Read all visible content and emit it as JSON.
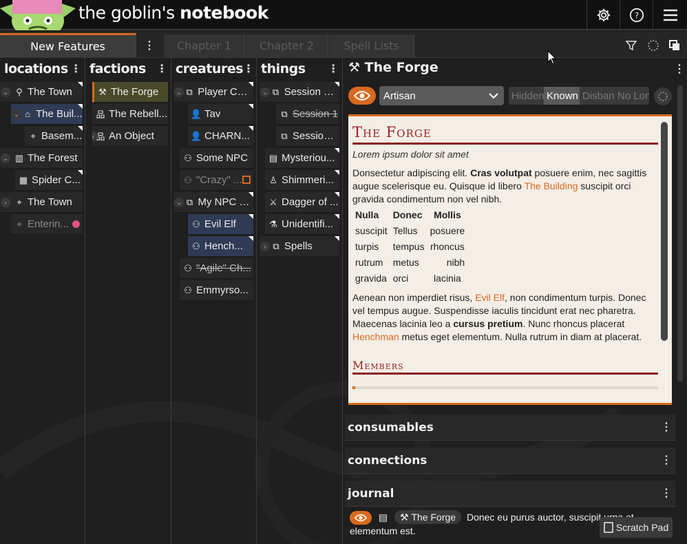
{
  "app": {
    "title_a": "the goblin's ",
    "title_b": "notebook"
  },
  "tabs": [
    {
      "label": "New Features"
    },
    {
      "label": "Chapter 1"
    },
    {
      "label": "Chapter 2"
    },
    {
      "label": "Spell Lists"
    }
  ],
  "columns": {
    "locations": {
      "title": "locations",
      "items": [
        "The Town",
        "The Buil...",
        "Basem...",
        "The Forest",
        "Spider C...",
        "The Town",
        "Enterin..."
      ]
    },
    "factions": {
      "title": "factions",
      "items": [
        "The Forge",
        "The Rebell...",
        "An Object"
      ]
    },
    "creatures": {
      "title": "creatures",
      "items": [
        "Player Cha...",
        "Tav",
        "CHARN...",
        "Some NPC",
        "\"Crazy\" ...",
        "My NPC G...",
        "Evil Elf",
        "Hench...",
        "\"Agile\" Ch...",
        "Emmyrso..."
      ]
    },
    "things": {
      "title": "things",
      "items": [
        "Session Pl...",
        "Session 1",
        "Session ...",
        "Mysteriou...",
        "Shimmeri...",
        "Dagger of ...",
        "Unidentifi...",
        "Spells"
      ]
    }
  },
  "panel": {
    "title": "The Forge",
    "type_select": "Artisan",
    "status_options": [
      "Hidden",
      "Known",
      "Disbanded",
      "No Longer"
    ],
    "status_selected": "Known",
    "card": {
      "heading": "The Forge",
      "subtitle": "Lorem ipsum dolor sit amet",
      "p1a": "Donsectetur adipiscing elit. ",
      "p1b": "Cras volutpat",
      "p1c": " posuere enim, nec sagittis augue scelerisque eu. Quisque id libero ",
      "p1link": "The Building",
      "p1d": " suscipit orci gravida condimentum non vel nibh.",
      "table": {
        "headers": [
          "Nulla",
          "Donec",
          "Mollis"
        ],
        "rows": [
          [
            "suscipit",
            "Tellus",
            "posuere"
          ],
          [
            "turpis",
            "tempus",
            "rhoncus"
          ],
          [
            "rutrum",
            "metus",
            "nibh"
          ],
          [
            "gravida",
            "orci",
            "lacinia"
          ]
        ]
      },
      "p2a": "Aenean non imperdiet risus, ",
      "p2link1": "Evil Elf",
      "p2b": ", non condimentum turpis. Donec vel tempus augue. Suspendisse iaculis tincidunt erat nec pharetra. Maecenas lacinia leo a ",
      "p2c": "cursus pretium",
      "p2d": ". Nunc rhoncus placerat ",
      "p2link2": "Henchman",
      "p2e": " metus eget elementum. Nulla rutrum in diam at placerat.",
      "members_heading": "Members"
    },
    "sections": [
      "consumables",
      "connections",
      "journal"
    ],
    "journal_entry": {
      "chip": "The Forge",
      "text": "Donec eu purus auctor, suscipit urna et elementum est."
    }
  },
  "scratch_pad": "Scratch Pad",
  "colors": {
    "accent": "#d86a1e",
    "heading_red": "#9c2222",
    "selected_blue": "#2f3a55"
  }
}
